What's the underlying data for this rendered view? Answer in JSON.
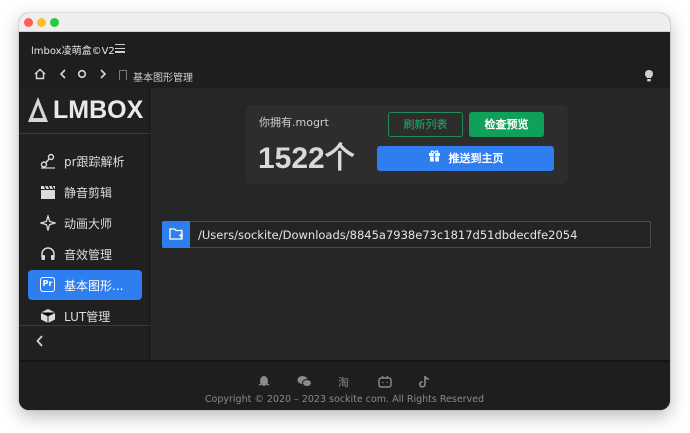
{
  "app": {
    "title": "lmbox凌萌盒©V2"
  },
  "nav": {
    "breadcrumb": "基本图形管理"
  },
  "logo": {
    "text": "LMBOX"
  },
  "sidebar": {
    "items": [
      {
        "label": "pr跟踪解析",
        "icon": "tracking-icon"
      },
      {
        "label": "静音剪辑",
        "icon": "clapperboard-icon"
      },
      {
        "label": "动画大师",
        "icon": "sparkle-icon"
      },
      {
        "label": "音效管理",
        "icon": "headphones-icon"
      },
      {
        "label": "基本图形...",
        "icon": "pr-icon",
        "badge": "Pr",
        "active": true
      },
      {
        "label": "LUT管理",
        "icon": "cube-icon"
      }
    ]
  },
  "card": {
    "own_label": "你拥有.mogrt",
    "count": "1522个",
    "refresh_label": "刷新列表",
    "check_label": "检查预览",
    "push_label": "推送到主页"
  },
  "path": {
    "value": "/Users/sockite/Downloads/8845a7938e73c1817d51dbdecdfe2054"
  },
  "footer": {
    "copyright": "Copyright © 2020 – 2023 sockite com. All Rights Reserved"
  },
  "colors": {
    "accent": "#2f7ef0",
    "success": "#0fa15a",
    "background": "#252525"
  }
}
